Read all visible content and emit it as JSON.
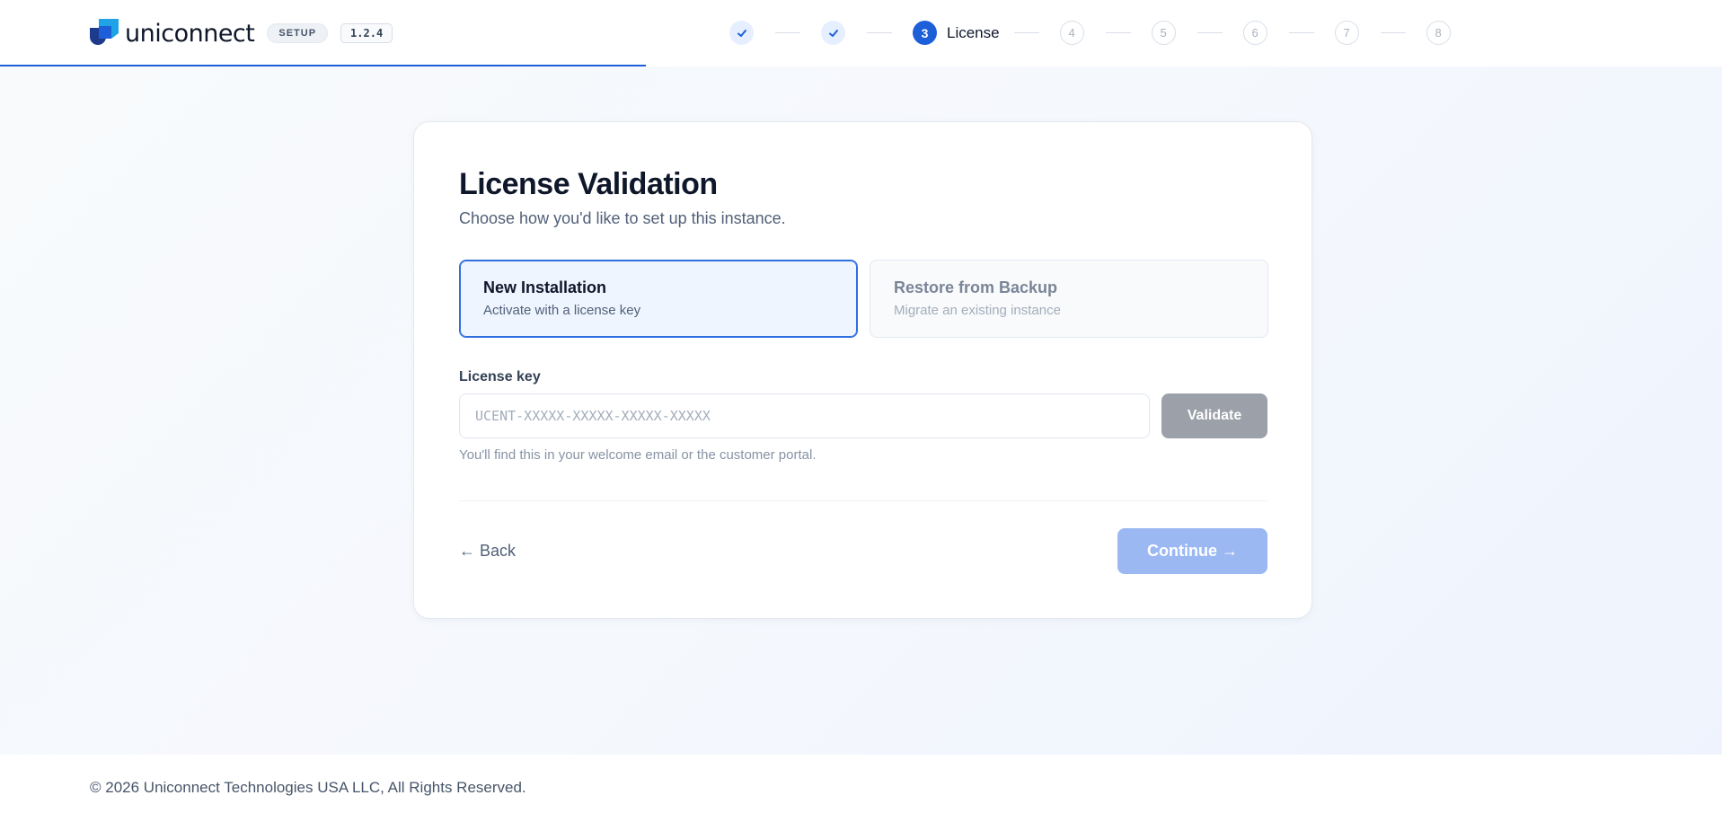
{
  "brand": {
    "name": "uniconnect",
    "setup_badge": "SETUP",
    "version": "1.2.4"
  },
  "stepper": {
    "current_label": "License",
    "steps": [
      "",
      "",
      "3",
      "4",
      "5",
      "6",
      "7",
      "8"
    ]
  },
  "card": {
    "title": "License Validation",
    "subtitle": "Choose how you'd like to set up this instance.",
    "modes": [
      {
        "title": "New Installation",
        "desc": "Activate with a license key"
      },
      {
        "title": "Restore from Backup",
        "desc": "Migrate an existing instance"
      }
    ],
    "license_label": "License key",
    "license_placeholder": "UCENT-XXXXX-XXXXX-XXXXX-XXXXX",
    "license_value": "",
    "validate_label": "Validate",
    "hint": "You'll find this in your welcome email or the customer portal.",
    "back_label": "← Back",
    "continue_label": "Continue →"
  },
  "footer": {
    "copyright": "© 2026 Uniconnect Technologies USA LLC, All Rights Reserved."
  },
  "colors": {
    "accent": "#1d5fd8",
    "continue_disabled": "#9bb8f3",
    "validate_disabled": "#9ca1a9"
  },
  "setup_progress": 0.375
}
